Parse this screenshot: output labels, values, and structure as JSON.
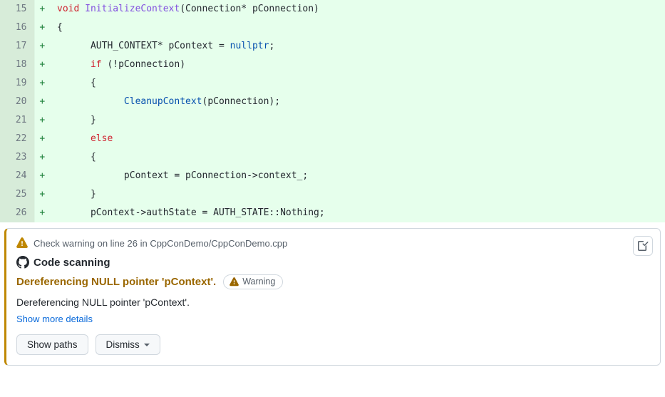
{
  "code": {
    "lines": [
      {
        "num": "15",
        "mark": "+",
        "html": "<span class='k-void'>void</span> <span class='k-fn'>InitializeContext</span>(Connection* pConnection)"
      },
      {
        "num": "16",
        "mark": "+",
        "html": "{"
      },
      {
        "num": "17",
        "mark": "+",
        "html": "      AUTH_CONTEXT* pContext = <span class='k-null'>nullptr</span>;"
      },
      {
        "num": "18",
        "mark": "+",
        "html": "      <span class='k-else'>if</span> (!pConnection)"
      },
      {
        "num": "19",
        "mark": "+",
        "html": "      {"
      },
      {
        "num": "20",
        "mark": "+",
        "html": "            <span class='k-call'>CleanupContext</span>(pConnection);"
      },
      {
        "num": "21",
        "mark": "+",
        "html": "      }"
      },
      {
        "num": "22",
        "mark": "+",
        "html": "      <span class='k-else'>else</span>"
      },
      {
        "num": "23",
        "mark": "+",
        "html": "      {"
      },
      {
        "num": "24",
        "mark": "+",
        "html": "            pContext = pConnection-&gt;context_;"
      },
      {
        "num": "25",
        "mark": "+",
        "html": "      }"
      },
      {
        "num": "26",
        "mark": "+",
        "html": "      pContext-&gt;authState = AUTH_STATE::Nothing;"
      }
    ]
  },
  "alert": {
    "header_text": "Check warning on line 26 in CppConDemo/CppConDemo.cpp",
    "scan_label": "Code scanning",
    "finding_title": "Dereferencing NULL pointer 'pContext'.",
    "badge_label": "Warning",
    "finding_body": "Dereferencing NULL pointer 'pContext'.",
    "show_more": "Show more details",
    "show_paths": "Show paths",
    "dismiss": "Dismiss"
  }
}
